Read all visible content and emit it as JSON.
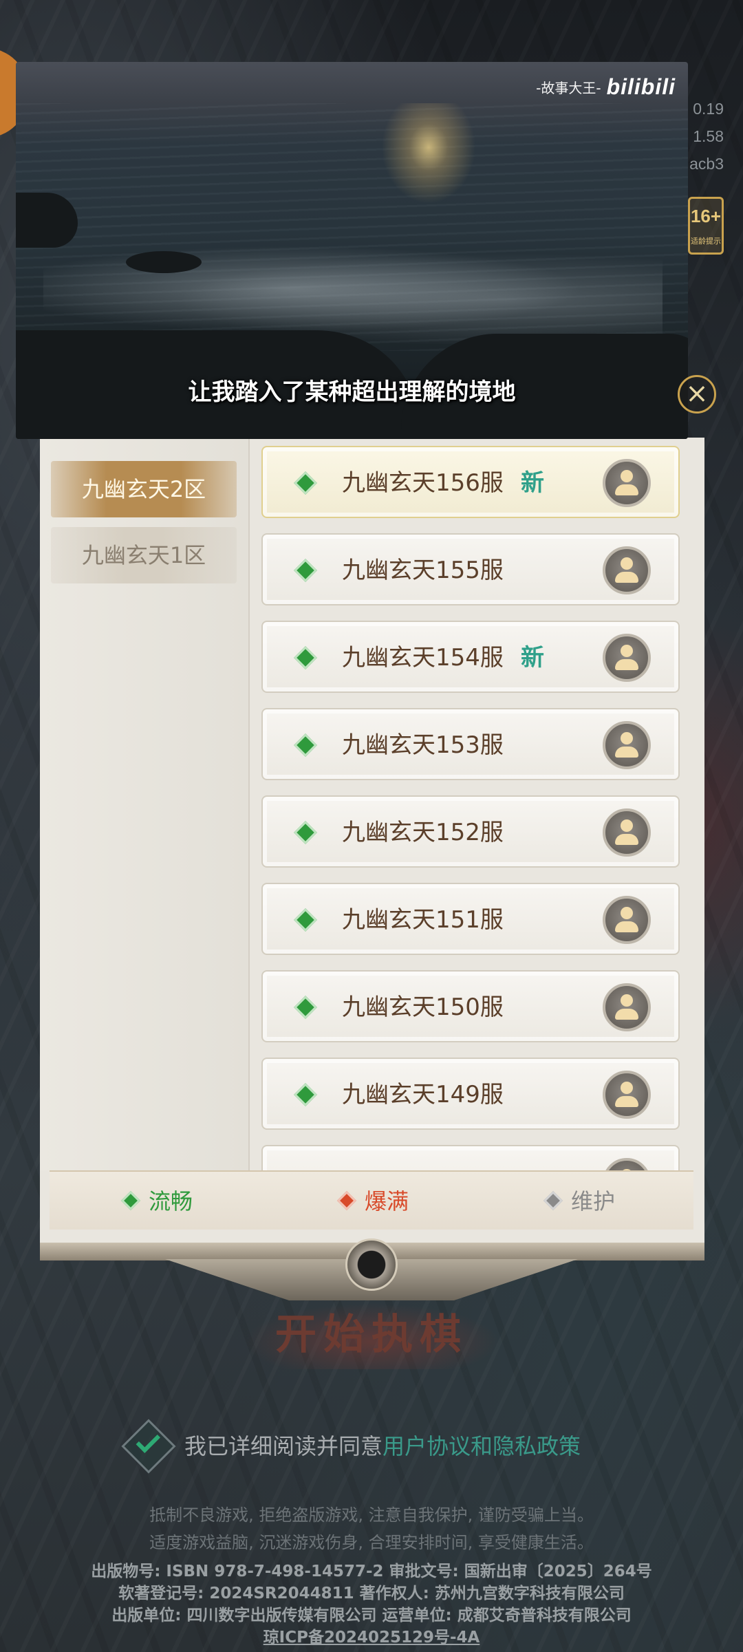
{
  "video": {
    "watermark_text": "-故事大王-",
    "watermark_logo": "bilibili",
    "subtitle": "让我踏入了某种超出理解的境地"
  },
  "corner_info": [
    "0.19",
    "1.58",
    "acb3"
  ],
  "age_badge": {
    "value": "16+",
    "caption": "适龄提示"
  },
  "close_icon": "close-icon",
  "zones": [
    {
      "label": "九幽玄天2区",
      "active": true
    },
    {
      "label": "九幽玄天1区",
      "active": false
    }
  ],
  "servers": [
    {
      "name": "九幽玄天156服",
      "tag": "新",
      "status": "流畅"
    },
    {
      "name": "九幽玄天155服",
      "tag": "",
      "status": "流畅"
    },
    {
      "name": "九幽玄天154服",
      "tag": "新",
      "status": "流畅"
    },
    {
      "name": "九幽玄天153服",
      "tag": "",
      "status": "流畅"
    },
    {
      "name": "九幽玄天152服",
      "tag": "",
      "status": "流畅"
    },
    {
      "name": "九幽玄天151服",
      "tag": "",
      "status": "流畅"
    },
    {
      "name": "九幽玄天150服",
      "tag": "",
      "status": "流畅"
    },
    {
      "name": "九幽玄天149服",
      "tag": "",
      "status": "流畅"
    }
  ],
  "legend": [
    {
      "label": "流畅",
      "color": "#2f9a3c"
    },
    {
      "label": "爆满",
      "color": "#d84a2a"
    },
    {
      "label": "维护",
      "color": "#8a8a8a"
    }
  ],
  "start_button": "开始执棋",
  "agreement": {
    "prefix": "我已详细阅读并同意",
    "link": "用户协议和隐私政策"
  },
  "footer": {
    "line1": "抵制不良游戏, 拒绝盗版游戏, 注意自我保护, 谨防受骗上当。",
    "line2": "适度游戏益脑, 沉迷游戏伤身, 合理安排时间, 享受健康生活。",
    "line3": "出版物号: ISBN 978-7-498-14577-2 审批文号: 国新出审〔2025〕264号",
    "line4": "软著登记号: 2024SR2044811 著作权人: 苏州九宫数字科技有限公司",
    "line5": "出版单位: 四川数字出版传媒有限公司 运营单位: 成都艾奇普科技有限公司",
    "line6": "琼ICP备2024025129号-4A"
  }
}
